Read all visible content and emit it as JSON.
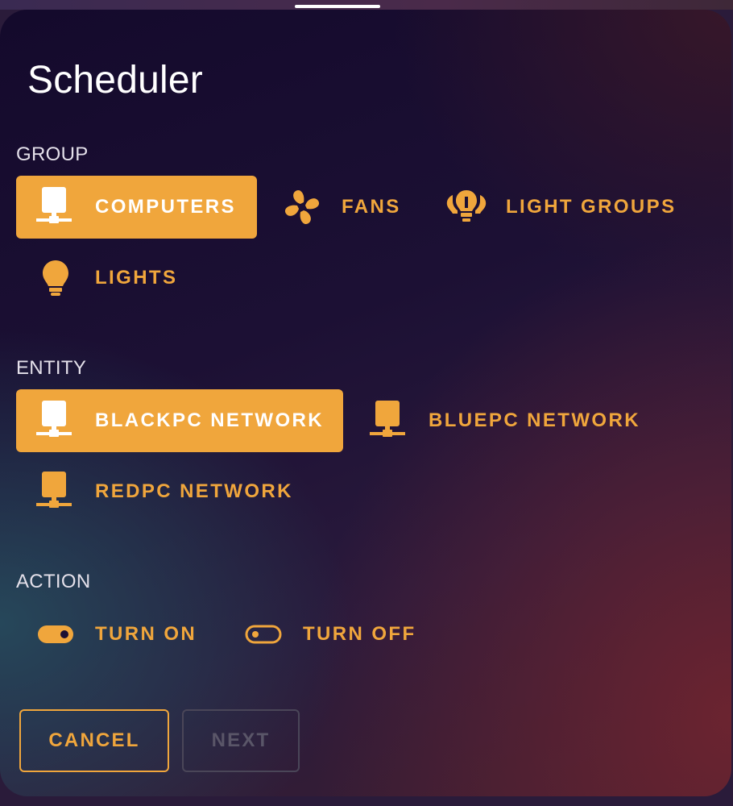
{
  "dialog": {
    "title": "Scheduler",
    "accent_color": "#f0a63c"
  },
  "group": {
    "label": "GROUP",
    "options": [
      {
        "label": "COMPUTERS",
        "icon": "network-computer-icon",
        "selected": true
      },
      {
        "label": "FANS",
        "icon": "fan-icon",
        "selected": false
      },
      {
        "label": "LIGHT GROUPS",
        "icon": "light-group-icon",
        "selected": false
      },
      {
        "label": "LIGHTS",
        "icon": "lightbulb-icon",
        "selected": false
      }
    ]
  },
  "entity": {
    "label": "ENTITY",
    "options": [
      {
        "label": "BLACKPC NETWORK",
        "icon": "network-computer-icon",
        "selected": true
      },
      {
        "label": "BLUEPC NETWORK",
        "icon": "network-computer-icon",
        "selected": false
      },
      {
        "label": "REDPC NETWORK",
        "icon": "network-computer-icon",
        "selected": false
      }
    ]
  },
  "action": {
    "label": "ACTION",
    "options": [
      {
        "label": "TURN ON",
        "icon": "toggle-on-icon",
        "selected": false
      },
      {
        "label": "TURN OFF",
        "icon": "toggle-off-icon",
        "selected": false
      }
    ]
  },
  "buttons": {
    "cancel": "CANCEL",
    "next": "NEXT",
    "next_enabled": false
  }
}
